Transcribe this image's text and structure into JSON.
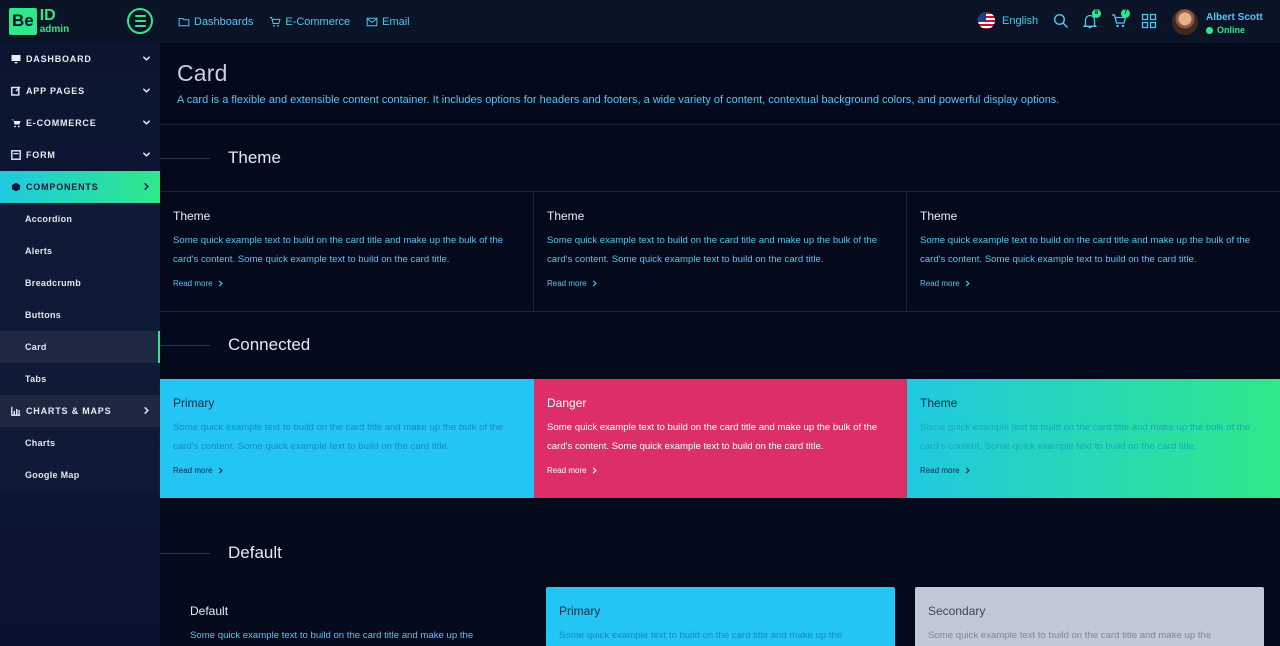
{
  "brand": {
    "logo_be": "Be",
    "logo_id": "ID",
    "logo_sub": "admin"
  },
  "topnav": [
    {
      "label": "Dashboards",
      "icon": "folder-icon"
    },
    {
      "label": "E-Commerce",
      "icon": "cart-icon"
    },
    {
      "label": "Email",
      "icon": "mail-icon"
    }
  ],
  "header": {
    "language": "English",
    "notifications_count": "8",
    "cart_count": "7",
    "user_name": "Albert Scott",
    "user_status": "Online"
  },
  "sidebar": {
    "items": [
      {
        "label": "DASHBOARD"
      },
      {
        "label": "APP PAGES"
      },
      {
        "label": "E-COMMERCE"
      },
      {
        "label": "FORM"
      },
      {
        "label": "COMPONENTS"
      },
      {
        "label": "CHARTS & MAPS"
      }
    ],
    "components_sub": [
      "Accordion",
      "Alerts",
      "Breadcrumb",
      "Buttons",
      "Card",
      "Tabs"
    ],
    "charts_sub": [
      "Charts",
      "Google Map"
    ]
  },
  "page": {
    "title": "Card",
    "description": "A card is a flexible and extensible content container. It includes options for headers and footers, a wide variety of content, contextual background colors, and powerful display options."
  },
  "sections": {
    "theme": "Theme",
    "connected": "Connected",
    "default": "Default"
  },
  "card_text": "Some quick example text to build on the card title and make up the bulk of the card's content. Some quick example text to build on the card title.",
  "card_text_short": "Some quick example text to build on the card title and make up the",
  "read_more": "Read more",
  "theme_cards": [
    "Theme",
    "Theme",
    "Theme"
  ],
  "connected_cards": [
    "Primary",
    "Danger",
    "Theme"
  ],
  "default_cards": [
    "Default",
    "Primary",
    "Secondary"
  ],
  "colors": {
    "accent": "#2ee88a",
    "info": "#4fc7f4",
    "primary": "#22c5f3",
    "danger": "#dc2f69",
    "secondary": "#c1c9d8",
    "background": "#05091c"
  }
}
